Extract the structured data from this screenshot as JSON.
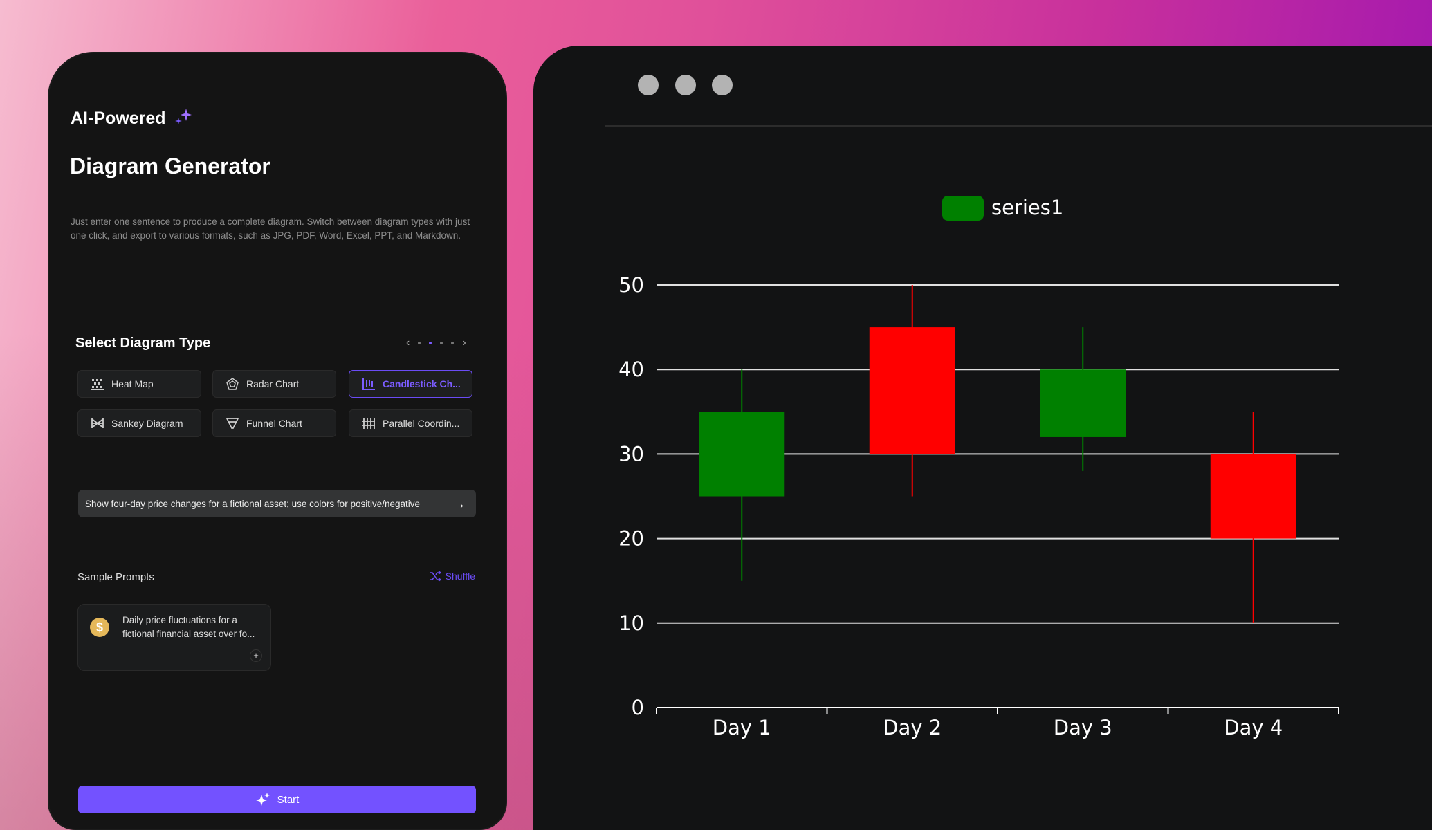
{
  "left_panel": {
    "eyebrow": "AI-Powered",
    "title": "Diagram Generator",
    "description": "Just enter one sentence to produce a complete diagram. Switch between diagram types with just one click, and export to various formats, such as JPG, PDF, Word, Excel, PPT, and Markdown.",
    "select_heading": "Select Diagram Type",
    "pager": {
      "prev": "‹",
      "next": "›",
      "pages": 4,
      "current": 2
    },
    "diagram_types": [
      {
        "label": "Heat Map",
        "icon": "heatmap-icon",
        "selected": false
      },
      {
        "label": "Radar Chart",
        "icon": "radar-icon",
        "selected": false
      },
      {
        "label": "Candlestick Ch...",
        "icon": "candlestick-icon",
        "selected": true
      },
      {
        "label": "Sankey Diagram",
        "icon": "sankey-icon",
        "selected": false
      },
      {
        "label": "Funnel Chart",
        "icon": "funnel-icon",
        "selected": false
      },
      {
        "label": "Parallel Coordin...",
        "icon": "parallel-icon",
        "selected": false
      }
    ],
    "prompt_value": "Show four-day price changes for a fictional asset; use colors for positive/negative",
    "sample_heading": "Sample Prompts",
    "shuffle_label": "Shuffle",
    "sample_cards": [
      {
        "text": "Daily price fluctuations for a fictional financial asset over fo...",
        "icon": "dollar-coin-icon"
      }
    ],
    "start_label": "Start",
    "accent": "#7352ff"
  },
  "chart_data": {
    "type": "candlestick",
    "categories": [
      "Day 1",
      "Day 2",
      "Day 3",
      "Day 4"
    ],
    "series": [
      {
        "name": "series1",
        "values": [
          {
            "open": 25,
            "close": 35,
            "low": 15,
            "high": 40
          },
          {
            "open": 45,
            "close": 30,
            "low": 25,
            "high": 50
          },
          {
            "open": 32,
            "close": 40,
            "low": 28,
            "high": 45
          },
          {
            "open": 30,
            "close": 20,
            "low": 10,
            "high": 35
          }
        ]
      }
    ],
    "ylim": [
      0,
      50
    ],
    "yticks": [
      0,
      10,
      20,
      30,
      40,
      50
    ],
    "grid": true,
    "legend": "top-center",
    "colors": {
      "up": "#008000",
      "down": "#ff0000"
    }
  }
}
